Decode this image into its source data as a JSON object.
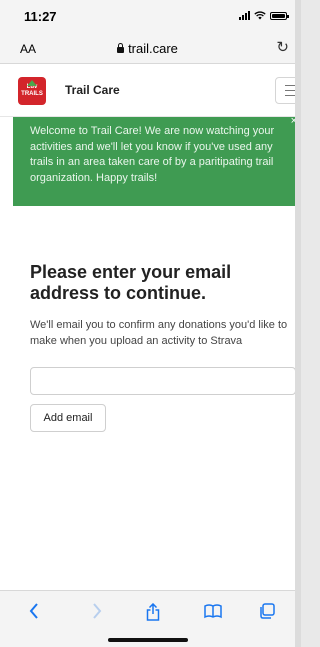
{
  "status_bar": {
    "time": "11:27"
  },
  "browser": {
    "text_size_label": "AA",
    "url": "trail.care",
    "reload_icon": "reload-icon"
  },
  "site": {
    "logo_text_line1": "Luv",
    "logo_text_line2": "TRAILS",
    "brand": "Trail Care",
    "menu_icon": "hamburger-icon"
  },
  "alert": {
    "message": "Welcome to Trail Care! We are now watching your activities and we'll let you know if you've used any trails in an area taken care of by a paritipating trail organization. Happy trails!",
    "close_label": "×"
  },
  "main": {
    "heading": "Please enter your email address to continue.",
    "description": "We'll email you to confirm any donations you'd like to make when you upload an activity to Strava",
    "email_value": "",
    "email_placeholder": "",
    "add_button_label": "Add email"
  },
  "toolbar": {
    "items": [
      "back-icon",
      "forward-icon",
      "share-icon",
      "bookmarks-icon",
      "tabs-icon"
    ]
  },
  "colors": {
    "alert_bg": "#3f9b52",
    "logo_bg": "#d3252b",
    "accent": "#1976f0"
  }
}
